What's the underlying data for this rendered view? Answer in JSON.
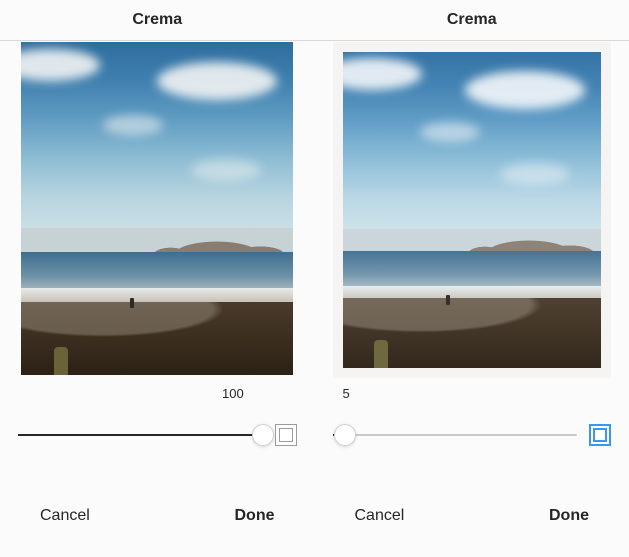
{
  "panes": [
    {
      "title": "Crema",
      "slider_value": "100",
      "slider_percent": 100,
      "frame_toggle_active": false,
      "cancel_label": "Cancel",
      "done_label": "Done"
    },
    {
      "title": "Crema",
      "slider_value": "5",
      "slider_percent": 5,
      "frame_toggle_active": true,
      "cancel_label": "Cancel",
      "done_label": "Done"
    }
  ]
}
